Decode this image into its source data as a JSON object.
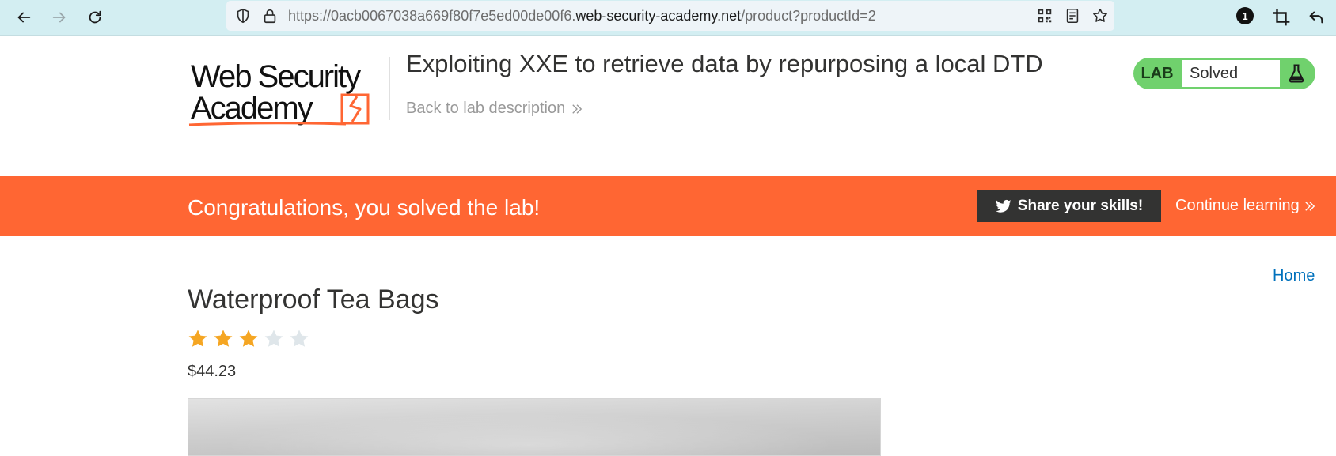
{
  "browser": {
    "url_prefix": "https://0acb0067038a669f80f7e5ed00de00f6.",
    "url_domain": "web-security-academy.net",
    "url_path": "/product?productId=2",
    "extension_badge": "1",
    "icons": [
      "back-arrow-icon",
      "forward-arrow-icon",
      "reload-icon",
      "shield-icon",
      "lock-icon",
      "qr-code-icon",
      "reader-view-icon",
      "bookmark-star-icon",
      "crop-icon",
      "undo-arrow-icon"
    ]
  },
  "header": {
    "logo_line1": "Web Security",
    "logo_line2": "Academy",
    "lab_title": "Exploiting XXE to retrieve data by repurposing a local DTD",
    "back_link": "Back to lab description",
    "lab_label": "LAB",
    "lab_status": "Solved"
  },
  "banner": {
    "message": "Congratulations, you solved the lab!",
    "share_label": "Share your skills!",
    "continue_label": "Continue learning"
  },
  "product": {
    "home_link": "Home",
    "title": "Waterproof Tea Bags",
    "rating": 3,
    "rating_max": 5,
    "price": "$44.23"
  },
  "colors": {
    "accent_orange": "#ff6633",
    "solved_green": "#70d16d",
    "star_filled": "#f5a623",
    "star_empty": "#dfe6ea",
    "link_blue": "#0071bc"
  }
}
